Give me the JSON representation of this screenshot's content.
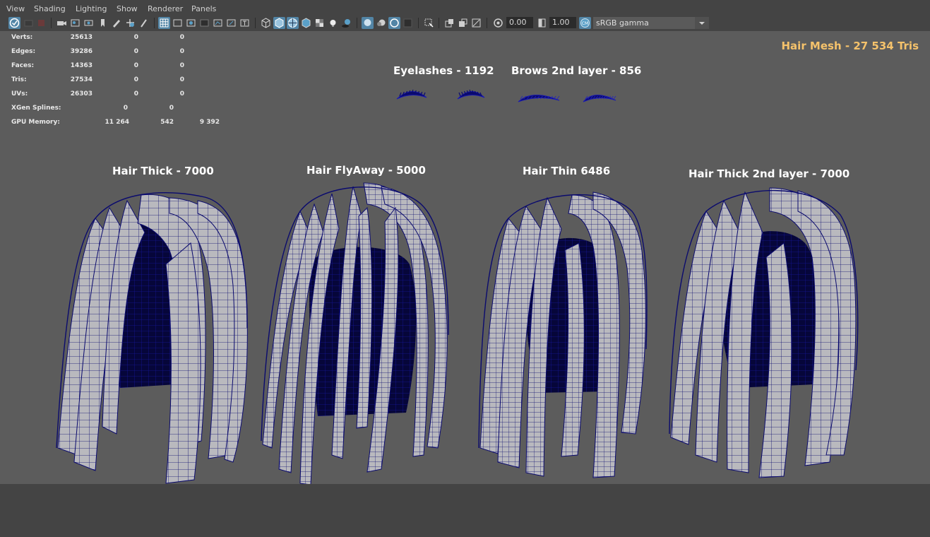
{
  "menu": [
    "View",
    "Shading",
    "Lighting",
    "Show",
    "Renderer",
    "Panels"
  ],
  "toolbar": {
    "exposure": "0.00",
    "gamma": "1.00",
    "color_space": "sRGB gamma"
  },
  "hud": {
    "rows": [
      {
        "label": "Verts:",
        "values": [
          "25613",
          "0",
          "0"
        ]
      },
      {
        "label": "Edges:",
        "values": [
          "39286",
          "0",
          "0"
        ]
      },
      {
        "label": "Faces:",
        "values": [
          "14363",
          "0",
          "0"
        ]
      },
      {
        "label": "Tris:",
        "values": [
          "27534",
          "0",
          "0"
        ]
      },
      {
        "label": "UVs:",
        "values": [
          "26303",
          "0",
          "0"
        ]
      },
      {
        "label": "XGen Splines:",
        "values": [
          "0",
          "0"
        ]
      },
      {
        "label": "GPU Memory:",
        "values": [
          "11 264",
          "542",
          "9 392"
        ]
      }
    ]
  },
  "headline": "Hair Mesh - 27 534 Tris",
  "labels": {
    "eyelashes": "Eyelashes - 1192",
    "brows": "Brows 2nd layer - 856",
    "hair_thick": "Hair Thick - 7000",
    "hair_flyaway": "Hair FlyAway - 5000",
    "hair_thin": "Hair Thin 6486",
    "hair_thick2": "Hair Thick 2nd layer - 7000"
  },
  "colors": {
    "viewport": "#5c5c5c",
    "ui": "#444444",
    "wire": "#0b0b6e",
    "mesh": "#b8b8bc",
    "accent": "#f5c26b",
    "active": "#5285a6"
  }
}
